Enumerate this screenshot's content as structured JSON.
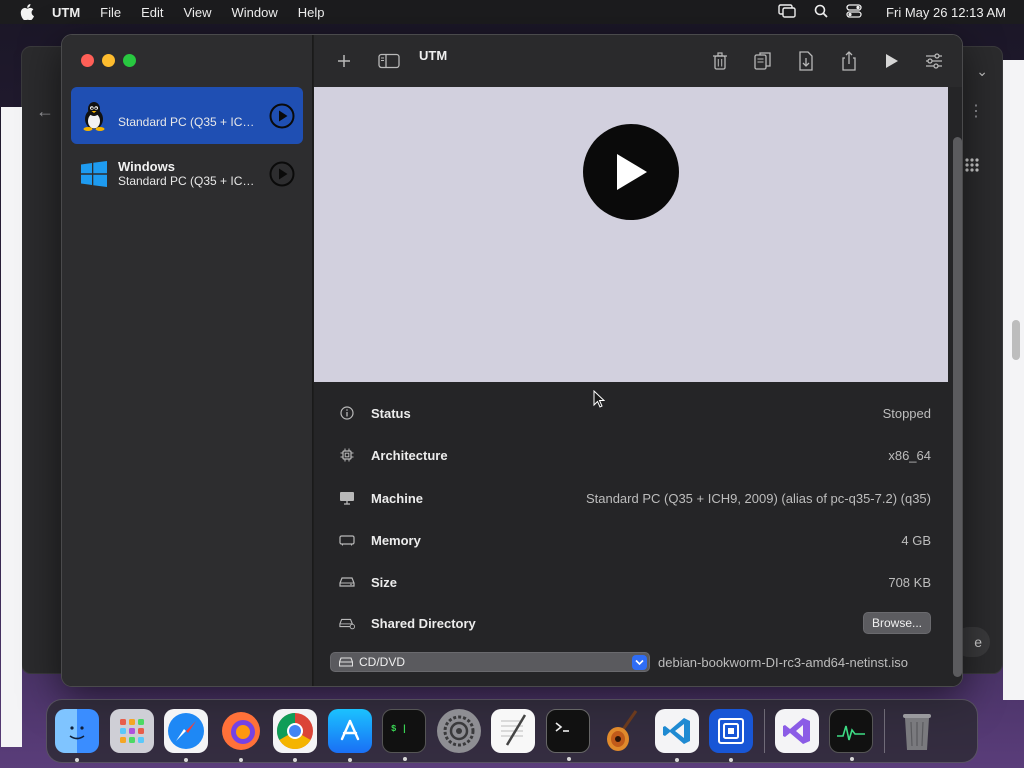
{
  "menubar": {
    "app_name": "UTM",
    "items": [
      "File",
      "Edit",
      "View",
      "Window",
      "Help"
    ],
    "clock": "Fri May 26  12:13 AM"
  },
  "window": {
    "title": "UTM"
  },
  "sidebar": {
    "vms": [
      {
        "name": "",
        "subtitle": "Standard PC (Q35 + ICH...",
        "icon": "linux-tux-icon",
        "selected": true
      },
      {
        "name": "Windows",
        "subtitle": "Standard PC (Q35 + ICH...",
        "icon": "windows-logo-icon",
        "selected": false
      }
    ]
  },
  "details": {
    "rows": [
      {
        "label": "Status",
        "value": "Stopped",
        "icon": "info-icon"
      },
      {
        "label": "Architecture",
        "value": "x86_64",
        "icon": "cpu-icon"
      },
      {
        "label": "Machine",
        "value": "Standard PC (Q35 + ICH9, 2009) (alias of pc-q35-7.2) (q35)",
        "icon": "display-icon"
      },
      {
        "label": "Memory",
        "value": "4 GB",
        "icon": "memory-icon"
      },
      {
        "label": "Size",
        "value": "708 KB",
        "icon": "drive-icon"
      },
      {
        "label": "Shared Directory",
        "icon": "shared-drive-icon",
        "button": "Browse..."
      }
    ],
    "cd_dvd": {
      "select_value": "CD/DVD",
      "path": "debian-bookworm-DI-rc3-amd64-netinst.iso"
    }
  },
  "bg_window": {
    "pill_text": "e"
  },
  "dock": {
    "apps": [
      "finder",
      "launchpad",
      "safari",
      "firefox",
      "chrome",
      "app-store",
      "terminal-green",
      "system-settings",
      "textedit",
      "terminal",
      "garageband",
      "vscode",
      "utm",
      "visual-studio",
      "activity-monitor",
      "trash"
    ]
  },
  "colors": {
    "selection": "#1f4fb3",
    "preview_bg": "#d2d0de",
    "accent": "#2f6df6"
  }
}
